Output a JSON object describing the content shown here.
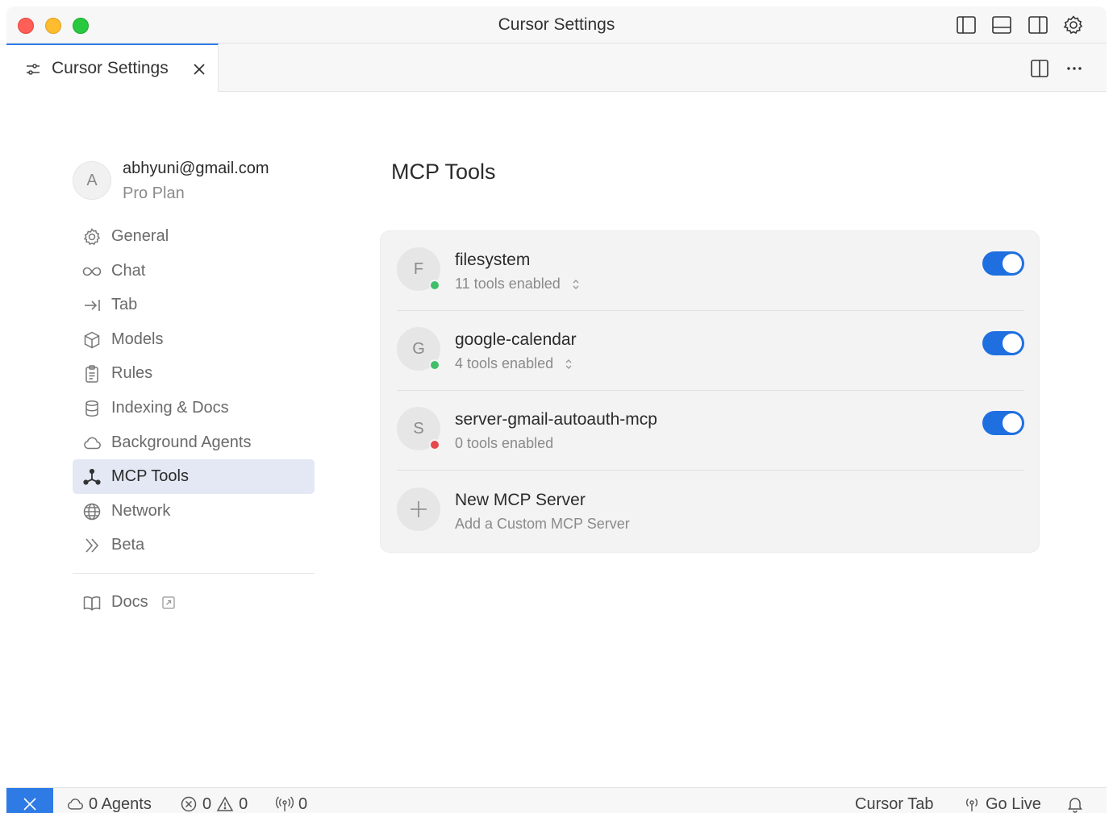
{
  "window": {
    "title": "Cursor Settings"
  },
  "tab": {
    "label": "Cursor Settings"
  },
  "account": {
    "avatar_letter": "A",
    "email": "abhyuni@gmail.com",
    "plan": "Pro Plan"
  },
  "sidebar": {
    "items": [
      {
        "label": "General",
        "icon": "gear-icon"
      },
      {
        "label": "Chat",
        "icon": "infinity-icon"
      },
      {
        "label": "Tab",
        "icon": "tab-arrow-icon"
      },
      {
        "label": "Models",
        "icon": "cube-icon"
      },
      {
        "label": "Rules",
        "icon": "clipboard-icon"
      },
      {
        "label": "Indexing & Docs",
        "icon": "database-icon"
      },
      {
        "label": "Background Agents",
        "icon": "cloud-icon"
      },
      {
        "label": "MCP Tools",
        "icon": "mcp-nodes-icon",
        "active": true
      },
      {
        "label": "Network",
        "icon": "globe-icon"
      },
      {
        "label": "Beta",
        "icon": "double-chevron-icon"
      }
    ],
    "docs_label": "Docs"
  },
  "main": {
    "title": "MCP Tools",
    "servers": [
      {
        "letter": "F",
        "name": "filesystem",
        "subtitle": "11 tools enabled",
        "status": "running",
        "status_color": "#3fbf6a",
        "enabled": true
      },
      {
        "letter": "G",
        "name": "google-calendar",
        "subtitle": "4 tools enabled",
        "status": "running",
        "status_color": "#3fbf6a",
        "enabled": true
      },
      {
        "letter": "S",
        "name": "server-gmail-autoauth-mcp",
        "subtitle": "0 tools enabled",
        "status": "error",
        "status_color": "#e5484d",
        "enabled": true
      }
    ],
    "new_server": {
      "title": "New MCP Server",
      "subtitle": "Add a Custom MCP Server"
    }
  },
  "statusbar": {
    "agents": "0 Agents",
    "errors": "0",
    "warnings": "0",
    "ports": "0",
    "cursor_tab": "Cursor Tab",
    "go_live": "Go Live"
  },
  "colors": {
    "accent": "#1f6fe0",
    "active_nav_bg": "#e3e8f4",
    "running": "#3fbf6a",
    "error": "#e5484d"
  }
}
